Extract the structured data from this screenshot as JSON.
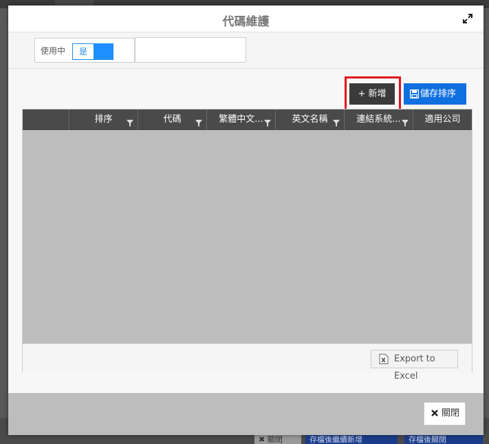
{
  "background": {
    "buttons": [
      "✖ 關閉",
      "存檔後繼續新增",
      "存檔後關閉"
    ]
  },
  "modal": {
    "title": "代碼維護",
    "expand_icon": "expand-icon"
  },
  "filter": {
    "label": "使用中",
    "toggle_value": "是"
  },
  "toolbar": {
    "add_label": "+ 新增",
    "save_order_label": "儲存排序"
  },
  "grid": {
    "columns": [
      "",
      "排序",
      "代碼",
      "繁體中文...",
      "英文名稱",
      "連結系統...",
      "適用公司"
    ],
    "rows": []
  },
  "export_label": "Export to Excel",
  "footer": {
    "close_label": "關閉"
  },
  "colors": {
    "accent": "#1070e0",
    "highlight": "#e0101a",
    "header_dark": "#4a4a4a"
  }
}
